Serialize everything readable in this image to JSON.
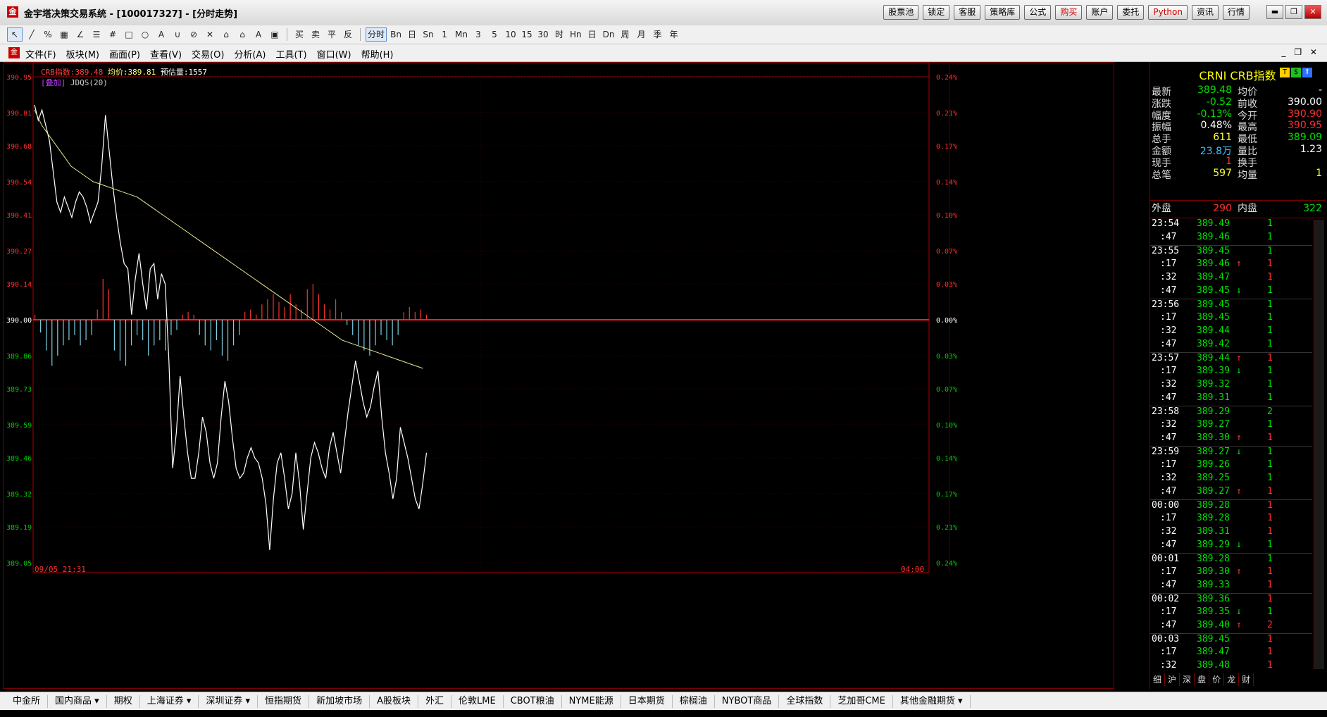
{
  "window": {
    "title": "金宇塔决策交易系统 - [100017327] - [分时走势]",
    "buttons": [
      "股票池",
      "锁定",
      "客服",
      "策略库",
      "公式",
      "购买",
      "账户",
      "委托",
      "Python",
      "资讯",
      "行情"
    ],
    "controls": [
      "▬",
      "❐",
      "✕"
    ]
  },
  "toolbar": {
    "tools": [
      "↖",
      "╱",
      "%",
      "▦",
      "∠",
      "☰",
      "#",
      "□",
      "○",
      "A",
      "∪",
      "⊘",
      "✕",
      "⌂",
      "⌂",
      "A",
      "▣"
    ],
    "actions": [
      "买",
      "卖",
      "平",
      "反"
    ],
    "periods": [
      "分时",
      "Bn",
      "日",
      "Sn",
      "1",
      "Mn",
      "3",
      "5",
      "10",
      "15",
      "30",
      "时",
      "Hn",
      "日",
      "Dn",
      "周",
      "月",
      "季",
      "年"
    ]
  },
  "menu": {
    "items": [
      "文件(F)",
      "板块(M)",
      "画面(P)",
      "查看(V)",
      "交易(O)",
      "分析(A)",
      "工具(T)",
      "窗口(W)",
      "帮助(H)"
    ],
    "mdi": "_ ❐ ✕"
  },
  "chart_header": {
    "name": "CRB指数:389.48",
    "avg": "均价:389.81",
    "est": "预估量:1557",
    "overlay_tag": "[叠加]",
    "overlay_name": "JDQS(20)",
    "start_time": "09/05 21:31",
    "end_time": "04:00"
  },
  "chart_data": {
    "type": "line",
    "prev_close": 390.0,
    "y_ticks_left": [
      "390.95",
      "390.81",
      "390.68",
      "390.54",
      "390.41",
      "390.27",
      "390.14",
      "390.00",
      "389.86",
      "389.73",
      "389.59",
      "389.46",
      "389.32",
      "389.19",
      "389.05"
    ],
    "y_ticks_right": [
      "0.24%",
      "0.21%",
      "0.17%",
      "0.14%",
      "0.10%",
      "0.07%",
      "0.03%",
      "0.00%",
      "0.03%",
      "0.07%",
      "0.10%",
      "0.14%",
      "0.17%",
      "0.21%",
      "0.24%"
    ],
    "ylim": [
      389.05,
      390.95
    ],
    "series": [
      {
        "name": "price",
        "color": "#ffffff",
        "values": [
          390.84,
          390.78,
          390.82,
          390.76,
          390.7,
          390.58,
          390.46,
          390.42,
          390.48,
          390.44,
          390.4,
          390.46,
          390.5,
          390.48,
          390.44,
          390.38,
          390.42,
          390.46,
          390.6,
          390.8,
          390.66,
          390.52,
          390.4,
          390.3,
          390.22,
          390.2,
          390.02,
          390.16,
          390.26,
          390.14,
          390.04,
          390.2,
          390.22,
          390.08,
          390.18,
          390.14,
          389.84,
          389.42,
          389.56,
          389.78,
          389.62,
          389.48,
          389.38,
          389.38,
          389.48,
          389.62,
          389.56,
          389.44,
          389.38,
          389.44,
          389.62,
          389.76,
          389.68,
          389.54,
          389.42,
          389.38,
          389.4,
          389.46,
          389.5,
          389.46,
          389.44,
          389.38,
          389.28,
          389.1,
          389.3,
          389.44,
          389.48,
          389.38,
          389.26,
          389.32,
          389.48,
          389.36,
          389.18,
          389.32,
          389.46,
          389.52,
          389.48,
          389.42,
          389.38,
          389.5,
          389.56,
          389.48,
          389.4,
          389.52,
          389.64,
          389.74,
          389.84,
          389.76,
          389.68,
          389.62,
          389.66,
          389.74,
          389.8,
          389.62,
          389.48,
          389.4,
          389.3,
          389.38,
          389.58,
          389.52,
          389.46,
          389.38,
          389.3,
          389.26,
          389.36,
          389.48
        ]
      },
      {
        "name": "avg",
        "color": "#e8e890",
        "values": [
          390.82,
          390.76,
          390.72,
          390.68,
          390.64,
          390.6,
          390.58,
          390.56,
          390.54,
          390.53,
          390.52,
          390.51,
          390.5,
          390.49,
          390.48,
          390.46,
          390.44,
          390.42,
          390.4,
          390.38,
          390.36,
          390.34,
          390.32,
          390.3,
          390.28,
          390.26,
          390.24,
          390.22,
          390.2,
          390.18,
          390.16,
          390.14,
          390.12,
          390.1,
          390.08,
          390.06,
          390.04,
          390.02,
          390.0,
          389.98,
          389.96,
          389.94,
          389.92,
          389.91,
          389.9,
          389.89,
          389.88,
          389.87,
          389.86,
          389.85,
          389.84,
          389.83,
          389.82,
          389.81
        ]
      }
    ],
    "histogram": [
      0.02,
      -0.05,
      -0.12,
      -0.18,
      -0.14,
      -0.1,
      -0.08,
      -0.06,
      -0.1,
      -0.08,
      -0.06,
      0.04,
      0.16,
      0.12,
      -0.12,
      -0.16,
      -0.18,
      -0.1,
      -0.06,
      -0.08,
      -0.14,
      -0.1,
      -0.08,
      -0.12,
      -0.06,
      -0.04,
      0.02,
      0.03,
      0.02,
      -0.06,
      -0.1,
      -0.12,
      -0.08,
      -0.14,
      -0.16,
      -0.1,
      -0.06,
      0.03,
      0.04,
      0.02,
      0.06,
      0.08,
      0.1,
      0.07,
      0.05,
      0.1,
      0.06,
      0.04,
      0.12,
      0.14,
      0.1,
      0.06,
      0.04,
      0.08,
      0.03,
      -0.02,
      -0.06,
      -0.1,
      -0.12,
      -0.14,
      -0.1,
      -0.06,
      -0.08,
      -0.1,
      -0.06,
      0.03,
      0.05,
      0.03,
      0.04,
      0.02
    ],
    "grid": true
  },
  "quote": {
    "title": "CRNI  CRB指数",
    "rows": [
      {
        "l1": "最新",
        "v1": "389.48",
        "c1": "green",
        "l2": "均价",
        "v2": "-",
        "c2": "white"
      },
      {
        "l1": "涨跌",
        "v1": "-0.52",
        "c1": "green",
        "l2": "前收",
        "v2": "390.00",
        "c2": "white"
      },
      {
        "l1": "幅度",
        "v1": "-0.13%",
        "c1": "green",
        "l2": "今开",
        "v2": "390.90",
        "c2": "red"
      },
      {
        "l1": "振幅",
        "v1": "0.48%",
        "c1": "white",
        "l2": "最高",
        "v2": "390.95",
        "c2": "red"
      },
      {
        "l1": "总手",
        "v1": "611",
        "c1": "yellow",
        "l2": "最低",
        "v2": "389.09",
        "c2": "green"
      },
      {
        "l1": "金额",
        "v1": "23.8万",
        "c1": "cyan",
        "l2": "量比",
        "v2": "1.23",
        "c2": "white"
      },
      {
        "l1": "现手",
        "v1": "1",
        "c1": "red",
        "l2": "换手",
        "v2": "",
        "c2": "white"
      },
      {
        "l1": "总笔",
        "v1": "597",
        "c1": "yellow",
        "l2": "均量",
        "v2": "1",
        "c2": "yellow"
      }
    ],
    "outer_label": "外盘",
    "outer_value": "290",
    "inner_label": "内盘",
    "inner_value": "322",
    "ticks": [
      {
        "t": "23:54",
        "p": "389.49",
        "a": "",
        "v": "1",
        "vc": "green"
      },
      {
        "t": ":47",
        "p": "389.46",
        "a": "",
        "v": "1",
        "vc": "green"
      },
      {
        "t": "23:55",
        "p": "389.45",
        "a": "",
        "v": "1",
        "vc": "green"
      },
      {
        "t": ":17",
        "p": "389.46",
        "a": "↑",
        "v": "1",
        "vc": "red"
      },
      {
        "t": ":32",
        "p": "389.47",
        "a": "",
        "v": "1",
        "vc": "red"
      },
      {
        "t": ":47",
        "p": "389.45",
        "a": "↓",
        "v": "1",
        "vc": "green"
      },
      {
        "t": "23:56",
        "p": "389.45",
        "a": "",
        "v": "1",
        "vc": "green"
      },
      {
        "t": ":17",
        "p": "389.45",
        "a": "",
        "v": "1",
        "vc": "green"
      },
      {
        "t": ":32",
        "p": "389.44",
        "a": "",
        "v": "1",
        "vc": "green"
      },
      {
        "t": ":47",
        "p": "389.42",
        "a": "",
        "v": "1",
        "vc": "green"
      },
      {
        "t": "23:57",
        "p": "389.44",
        "a": "↑",
        "v": "1",
        "vc": "red"
      },
      {
        "t": ":17",
        "p": "389.39",
        "a": "↓",
        "v": "1",
        "vc": "green"
      },
      {
        "t": ":32",
        "p": "389.32",
        "a": "",
        "v": "1",
        "vc": "green"
      },
      {
        "t": ":47",
        "p": "389.31",
        "a": "",
        "v": "1",
        "vc": "green"
      },
      {
        "t": "23:58",
        "p": "389.29",
        "a": "",
        "v": "2",
        "vc": "green"
      },
      {
        "t": ":32",
        "p": "389.27",
        "a": "",
        "v": "1",
        "vc": "green"
      },
      {
        "t": ":47",
        "p": "389.30",
        "a": "↑",
        "v": "1",
        "vc": "red"
      },
      {
        "t": "23:59",
        "p": "389.27",
        "a": "↓",
        "v": "1",
        "vc": "green"
      },
      {
        "t": ":17",
        "p": "389.26",
        "a": "",
        "v": "1",
        "vc": "green"
      },
      {
        "t": ":32",
        "p": "389.25",
        "a": "",
        "v": "1",
        "vc": "green"
      },
      {
        "t": ":47",
        "p": "389.27",
        "a": "↑",
        "v": "1",
        "vc": "red"
      },
      {
        "t": "00:00",
        "p": "389.28",
        "a": "",
        "v": "1",
        "vc": "red"
      },
      {
        "t": ":17",
        "p": "389.28",
        "a": "",
        "v": "1",
        "vc": "red"
      },
      {
        "t": ":32",
        "p": "389.31",
        "a": "",
        "v": "1",
        "vc": "red"
      },
      {
        "t": ":47",
        "p": "389.29",
        "a": "↓",
        "v": "1",
        "vc": "green"
      },
      {
        "t": "00:01",
        "p": "389.28",
        "a": "",
        "v": "1",
        "vc": "green"
      },
      {
        "t": ":17",
        "p": "389.30",
        "a": "↑",
        "v": "1",
        "vc": "red"
      },
      {
        "t": ":47",
        "p": "389.33",
        "a": "",
        "v": "1",
        "vc": "red"
      },
      {
        "t": "00:02",
        "p": "389.36",
        "a": "",
        "v": "1",
        "vc": "red"
      },
      {
        "t": ":17",
        "p": "389.35",
        "a": "↓",
        "v": "1",
        "vc": "green"
      },
      {
        "t": ":47",
        "p": "389.40",
        "a": "↑",
        "v": "2",
        "vc": "red"
      },
      {
        "t": "00:03",
        "p": "389.45",
        "a": "",
        "v": "1",
        "vc": "red"
      },
      {
        "t": ":17",
        "p": "389.47",
        "a": "",
        "v": "1",
        "vc": "red"
      },
      {
        "t": ":32",
        "p": "389.48",
        "a": "",
        "v": "1",
        "vc": "red"
      }
    ],
    "bottom_tabs": [
      "细",
      "沪",
      "深",
      "盘",
      "价",
      "龙",
      "财"
    ]
  },
  "market_tabs": [
    "中金所",
    "国内商品 ▾",
    "期权",
    "上海证券 ▾",
    "深圳证券 ▾",
    "恒指期货",
    "新加坡市场",
    "A股板块",
    "外汇",
    "伦敦LME",
    "CBOT粮油",
    "NYME能源",
    "日本期货",
    "棕榈油",
    "NYBOT商品",
    "全球指数",
    "芝加哥CME",
    "其他金融期货 ▾"
  ]
}
